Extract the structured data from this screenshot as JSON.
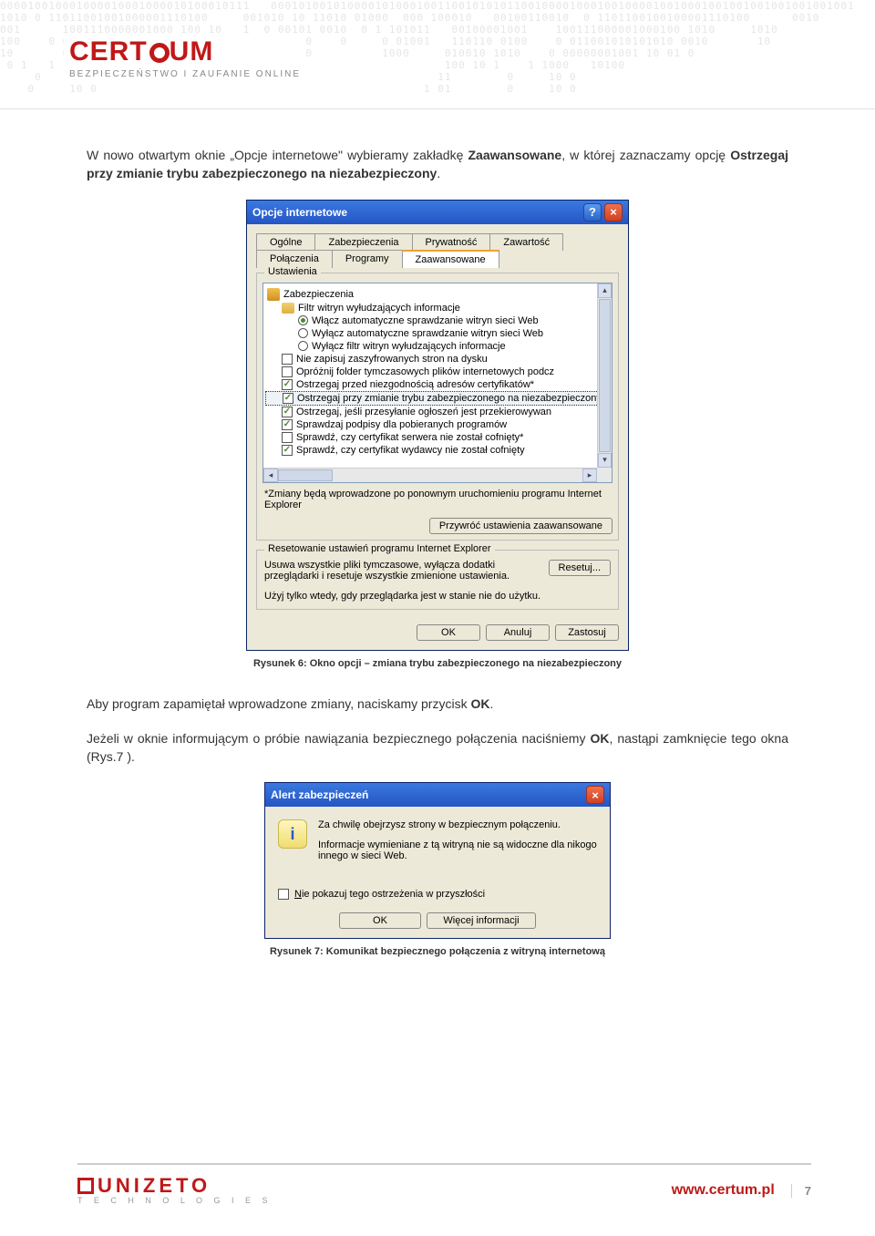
{
  "header": {
    "logo_text_part1": "CERT",
    "logo_text_part2": "UM",
    "logo_sub": "BEZPIECZEŃSTWO I ZAUFANIE ONLINE",
    "binary": "000010010001000010001000010100010111   000101001010000101000100110010101011001000010001001000010010001001001001001001001001\n1010 0 11011001001000001110100     001010 10 11010 01000  000 100010   00100110010  0 1101100100100001110100      0010\n001      1001110000001000 100 10   1  0 00101 0010  0 1 101011   00100001001    100111000001000100 1010     1010\n100    0 01100101010010 10 0010         10 10    0     0 01001   110110 0100    0 011001010101010 0010       10\n10       0 00000001001 10 01 0           0 00          1000     010010 1010    0 00000001001 10 01 0\n 0 1   1 1000   10100                    10                     100 10 1    1 1000   10100\n     0     10 0                                                11        0     10 0\n    0     10 0                                               1 01        0     10 0"
  },
  "body": {
    "para1_a": "W nowo otwartym oknie „Opcje internetowe\" wybieramy zakładkę ",
    "para1_b": "Zaawansowane",
    "para1_c": ", w której zaznaczamy opcję ",
    "para1_d": "Ostrzegaj przy zmianie trybu zabezpieczonego na niezabezpieczony",
    "para1_e": ".",
    "caption1": "Rysunek 6: Okno opcji – zmiana trybu zabezpieczonego na niezabezpieczony",
    "para2_a": "Aby program zapamiętał wprowadzone zmiany, naciskamy przycisk ",
    "para2_b": "OK",
    "para2_c": ".",
    "para3_a": "Jeżeli w oknie informującym o próbie nawiązania bezpiecznego połączenia naciśniemy ",
    "para3_b": "OK",
    "para3_c": ", nastąpi zamknięcie tego okna (Rys.7 ).",
    "caption2": "Rysunek 7: Komunikat bezpiecznego połączenia z witryną internetową"
  },
  "dialog1": {
    "title": "Opcje internetowe",
    "tabs_row1": [
      "Ogólne",
      "Zabezpieczenia",
      "Prywatność",
      "Zawartość"
    ],
    "tabs_row2": [
      "Połączenia",
      "Programy",
      "Zaawansowane"
    ],
    "active_tab": "Zaawansowane",
    "settings_legend": "Ustawienia",
    "tree": {
      "section": "Zabezpieczenia",
      "sub": "Filtr witryn wyłudzających informacje",
      "radios": [
        {
          "label": "Włącz automatyczne sprawdzanie witryn sieci Web",
          "selected": true
        },
        {
          "label": "Wyłącz automatyczne sprawdzanie witryn sieci Web",
          "selected": false
        },
        {
          "label": "Wyłącz filtr witryn wyłudzających informacje",
          "selected": false
        }
      ],
      "checks": [
        {
          "label": "Nie zapisuj zaszyfrowanych stron na dysku",
          "checked": false
        },
        {
          "label": "Opróżnij folder tymczasowych plików internetowych podcz",
          "checked": false
        },
        {
          "label": "Ostrzegaj przed niezgodnością adresów certyfikatów*",
          "checked": true
        },
        {
          "label": "Ostrzegaj przy zmianie trybu zabezpieczonego na niezabezpieczony",
          "checked": true,
          "highlight": true
        },
        {
          "label": "Ostrzegaj, jeśli przesyłanie ogłoszeń jest przekierowywan",
          "checked": true
        },
        {
          "label": "Sprawdzaj podpisy dla pobieranych programów",
          "checked": true
        },
        {
          "label": "Sprawdź, czy certyfikat serwera nie został cofnięty*",
          "checked": false
        },
        {
          "label": "Sprawdź, czy certyfikat wydawcy nie został cofnięty",
          "checked": true
        }
      ]
    },
    "note": "*Zmiany będą wprowadzone po ponownym uruchomieniu programu Internet Explorer",
    "btn_restore": "Przywróć ustawienia zaawansowane",
    "reset_legend": "Resetowanie ustawień programu Internet Explorer",
    "reset_text": "Usuwa wszystkie pliki tymczasowe, wyłącza dodatki przeglądarki i resetuje wszystkie zmienione ustawienia.",
    "btn_reset": "Resetuj...",
    "reset_foot": "Użyj tylko wtedy, gdy przeglądarka jest w stanie nie do użytku.",
    "btn_ok": "OK",
    "btn_cancel": "Anuluj",
    "btn_apply": "Zastosuj"
  },
  "dialog2": {
    "title": "Alert zabezpieczeń",
    "line1": "Za chwilę obejrzysz strony w bezpiecznym połączeniu.",
    "line2": "Informacje wymieniane z tą witryną nie są widoczne dla nikogo innego w sieci Web.",
    "chk_label": "Nie pokazuj tego ostrzeżenia w przyszłości",
    "btn_ok": "OK",
    "btn_more": "Więcej informacji"
  },
  "footer": {
    "brand": "UNIZETO",
    "brand_sub": "T E C H N O L O G I E S",
    "url": "www.certum.pl",
    "page": "7"
  }
}
